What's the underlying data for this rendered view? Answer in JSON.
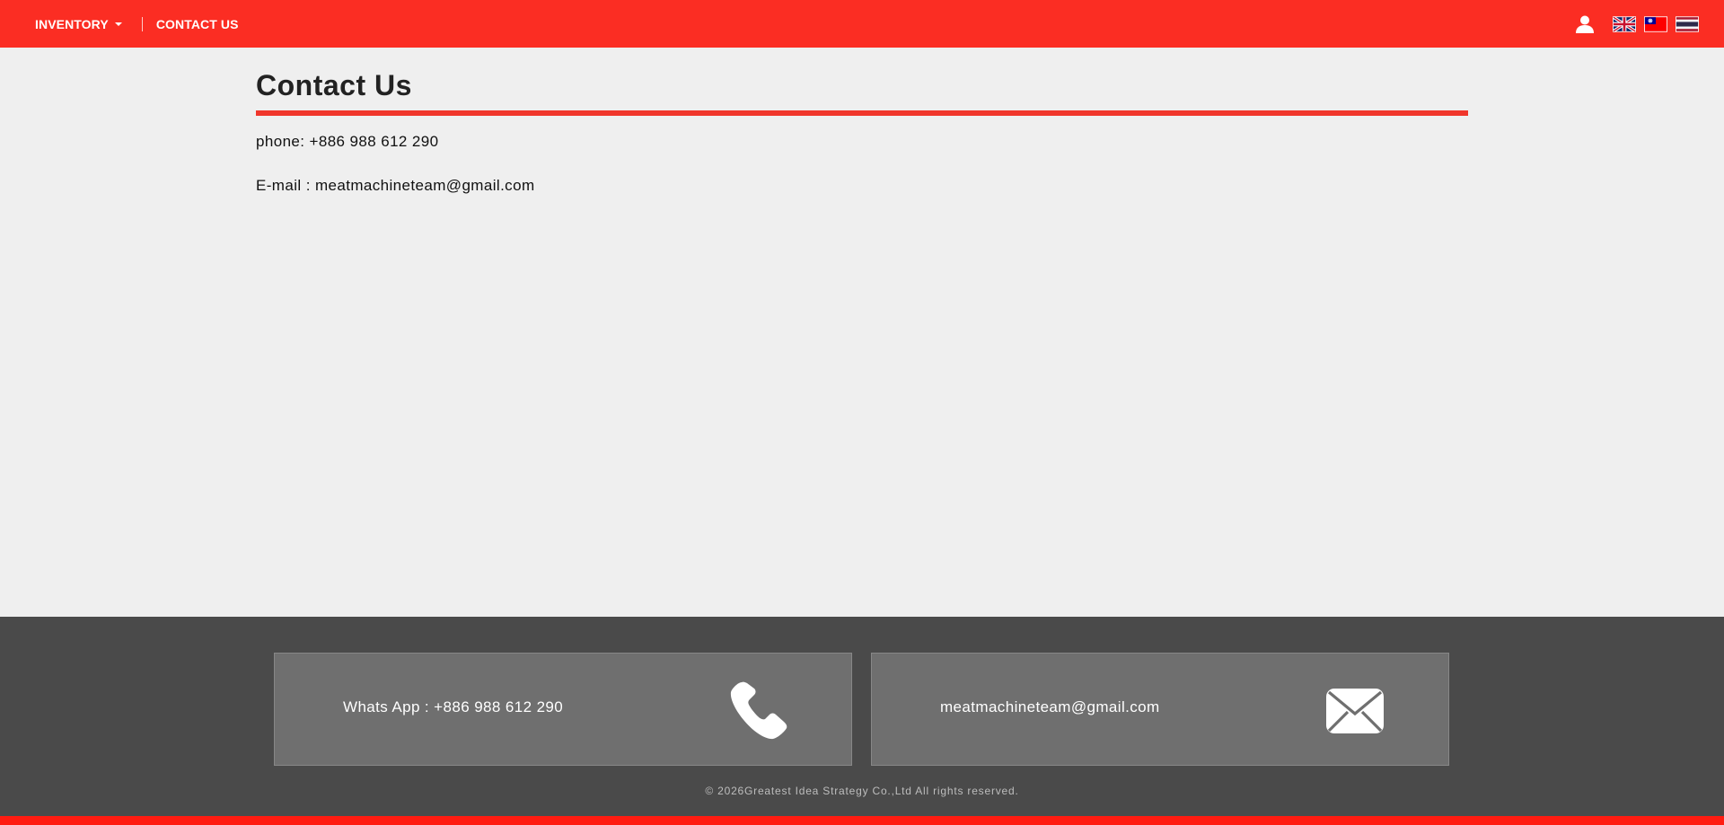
{
  "nav": {
    "items": [
      {
        "label": "INVENTORY",
        "has_dropdown": true
      },
      {
        "label": "CONTACT US",
        "has_dropdown": false
      }
    ]
  },
  "header_icons": {
    "user": "user-icon",
    "flags": [
      "uk-flag-icon",
      "taiwan-flag-icon",
      "thailand-flag-icon"
    ]
  },
  "page": {
    "title": "Contact Us",
    "phone_line": "phone: +886 988 612 290",
    "email_line": "E-mail : meatmachineteam@gmail.com"
  },
  "footer": {
    "whatsapp_text": "Whats App : +886 988 612 290",
    "email_text": "meatmachineteam@gmail.com",
    "copyright": "© 2026Greatest Idea Strategy Co.,Ltd All rights reserved."
  },
  "colors": {
    "brand_red": "#fb2d23",
    "page_bg": "#efefef",
    "footer_bg": "#4a4a4a",
    "card_bg": "#6f6f6f"
  }
}
